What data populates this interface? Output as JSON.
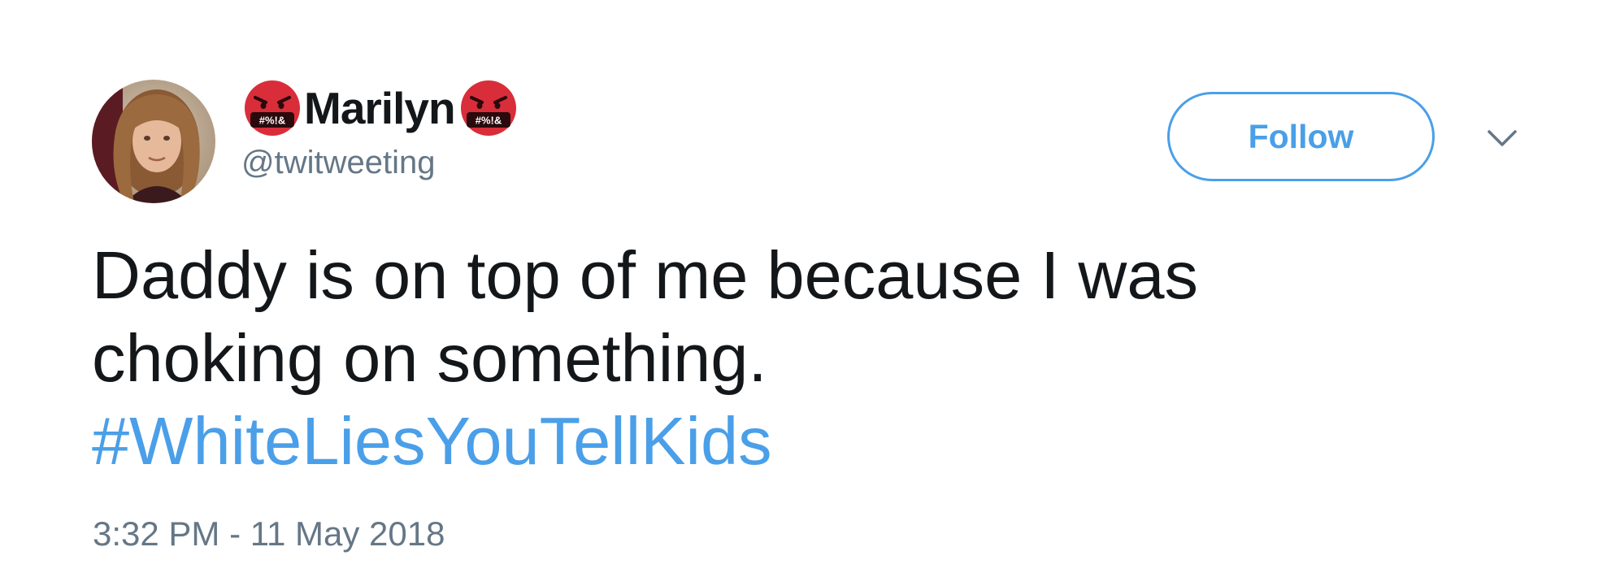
{
  "user": {
    "display_name": "Marilyn",
    "handle": "@twitweeting",
    "name_emoji_left": "angry-face-with-symbols-icon",
    "name_emoji_right": "angry-face-with-symbols-icon",
    "emoji_symbols": "#%!&"
  },
  "actions": {
    "follow_label": "Follow",
    "menu_icon": "chevron-down-icon"
  },
  "tweet": {
    "line1": "Daddy is on top of me because I was",
    "line2": "choking on something.",
    "hashtag": "#WhiteLiesYouTellKids",
    "timestamp": "3:32 PM - 11 May 2018"
  },
  "colors": {
    "accent": "#4a9fe8",
    "text": "#14171a",
    "secondary_text": "#657786",
    "emoji_red": "#d92d3a"
  }
}
